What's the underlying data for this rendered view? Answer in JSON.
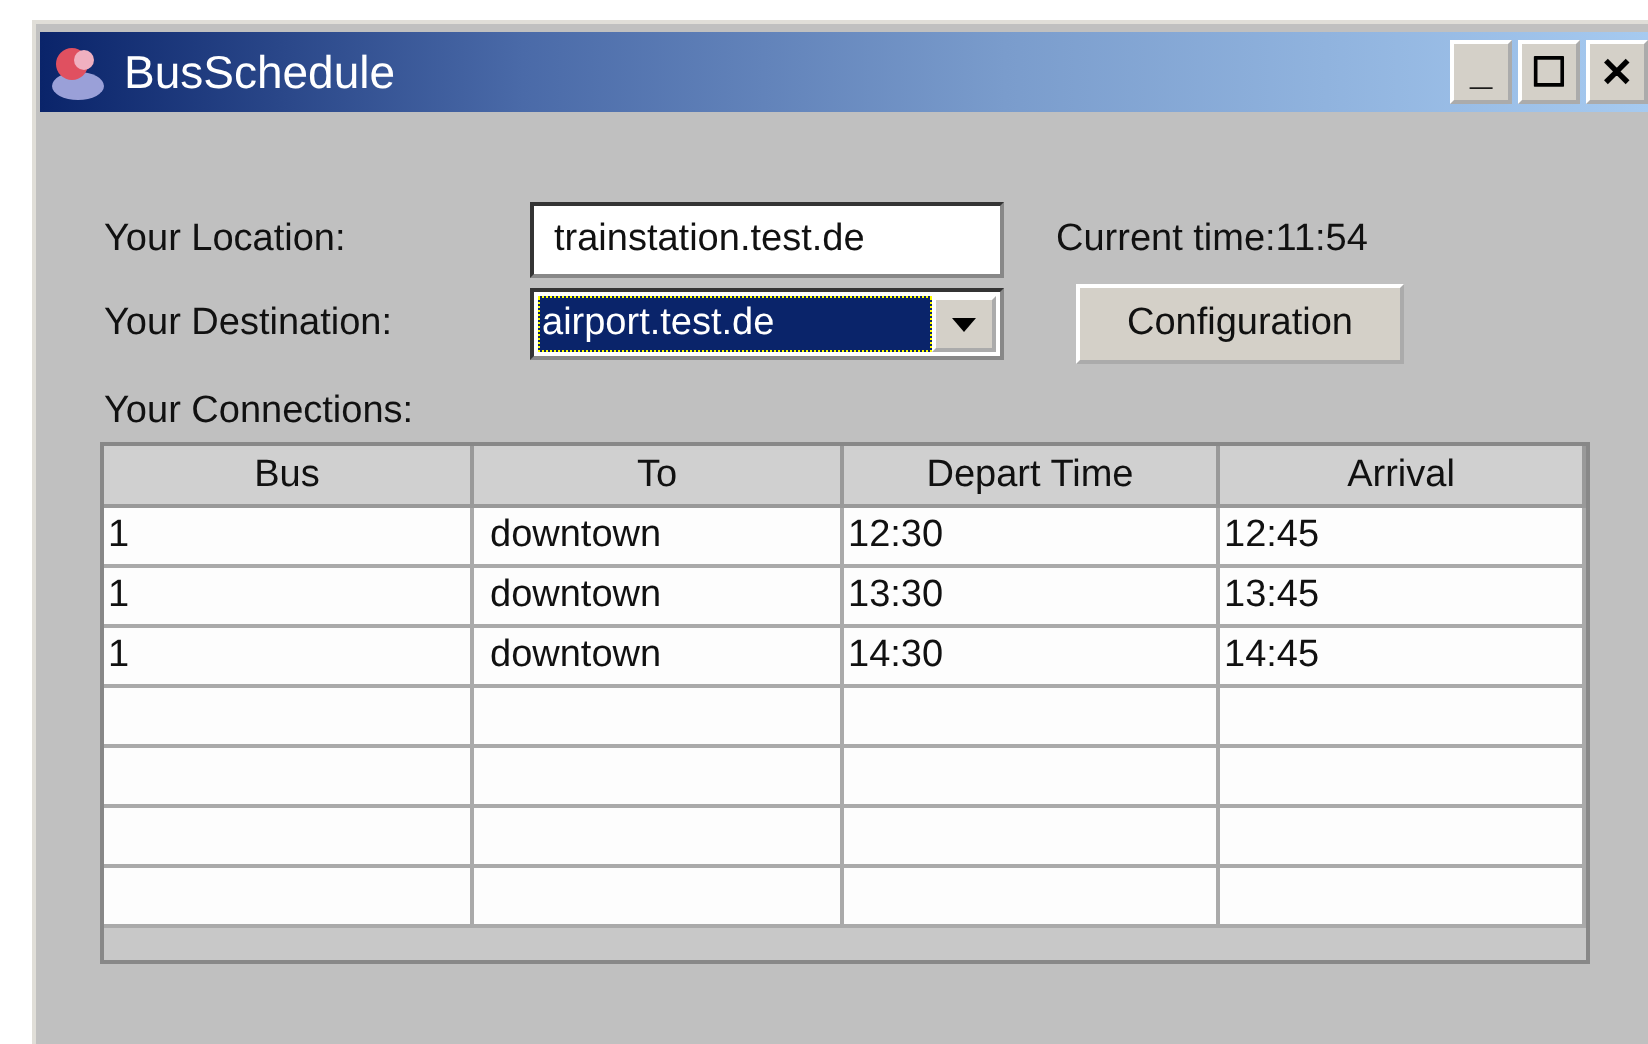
{
  "window": {
    "title": "BusSchedule",
    "controls": [
      "_",
      "☐",
      "✕"
    ]
  },
  "form": {
    "location_label": "Your Location:",
    "location_value": "trainstation.test.de",
    "current_time": "Current time:11:54",
    "destination_label": "Your Destination:",
    "destination_value": "airport.test.de",
    "configuration_button": "Configuration",
    "connections_label": "Your Connections:"
  },
  "table": {
    "columns": [
      "Bus",
      "To",
      "Depart Time",
      "Arrival"
    ],
    "rows": [
      [
        "1",
        "downtown",
        "12:30",
        "12:45"
      ],
      [
        "1",
        "downtown",
        "13:30",
        "13:45"
      ],
      [
        "1",
        "downtown",
        "14:30",
        "14:45"
      ]
    ]
  }
}
